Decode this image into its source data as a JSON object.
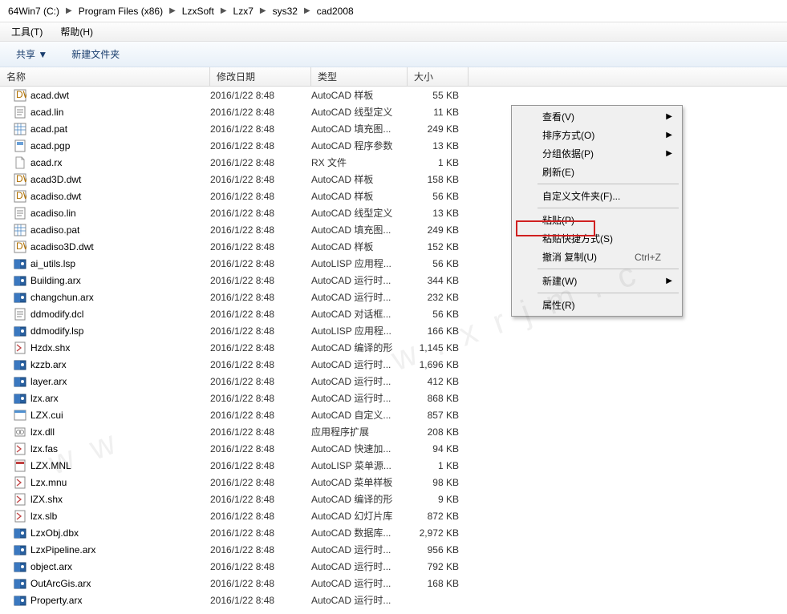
{
  "breadcrumb": [
    "64Win7 (C:)",
    "Program Files (x86)",
    "LzxSoft",
    "Lzx7",
    "sys32",
    "cad2008"
  ],
  "menubar": {
    "tools": "工具(T)",
    "help": "帮助(H)"
  },
  "toolbar": {
    "share": "共享 ▼",
    "newfolder": "新建文件夹"
  },
  "columns": {
    "name": "名称",
    "date": "修改日期",
    "type": "类型",
    "size": "大小"
  },
  "files": [
    {
      "icon": "dwt",
      "name": "acad.dwt",
      "date": "2016/1/22 8:48",
      "type": "AutoCAD 样板",
      "size": "55 KB"
    },
    {
      "icon": "txt",
      "name": "acad.lin",
      "date": "2016/1/22 8:48",
      "type": "AutoCAD 线型定义",
      "size": "11 KB"
    },
    {
      "icon": "pat",
      "name": "acad.pat",
      "date": "2016/1/22 8:48",
      "type": "AutoCAD 填充图...",
      "size": "249 KB"
    },
    {
      "icon": "gen",
      "name": "acad.pgp",
      "date": "2016/1/22 8:48",
      "type": "AutoCAD 程序参数",
      "size": "13 KB"
    },
    {
      "icon": "blank",
      "name": "acad.rx",
      "date": "2016/1/22 8:48",
      "type": "RX 文件",
      "size": "1 KB"
    },
    {
      "icon": "dwt",
      "name": "acad3D.dwt",
      "date": "2016/1/22 8:48",
      "type": "AutoCAD 样板",
      "size": "158 KB"
    },
    {
      "icon": "dwt",
      "name": "acadiso.dwt",
      "date": "2016/1/22 8:48",
      "type": "AutoCAD 样板",
      "size": "56 KB"
    },
    {
      "icon": "txt",
      "name": "acadiso.lin",
      "date": "2016/1/22 8:48",
      "type": "AutoCAD 线型定义",
      "size": "13 KB"
    },
    {
      "icon": "pat",
      "name": "acadiso.pat",
      "date": "2016/1/22 8:48",
      "type": "AutoCAD 填充图...",
      "size": "249 KB"
    },
    {
      "icon": "dwt",
      "name": "acadiso3D.dwt",
      "date": "2016/1/22 8:48",
      "type": "AutoCAD 样板",
      "size": "152 KB"
    },
    {
      "icon": "arx",
      "name": "ai_utils.lsp",
      "date": "2016/1/22 8:48",
      "type": "AutoLISP 应用程...",
      "size": "56 KB"
    },
    {
      "icon": "arx",
      "name": "Building.arx",
      "date": "2016/1/22 8:48",
      "type": "AutoCAD 运行时...",
      "size": "344 KB"
    },
    {
      "icon": "arx",
      "name": "changchun.arx",
      "date": "2016/1/22 8:48",
      "type": "AutoCAD 运行时...",
      "size": "232 KB"
    },
    {
      "icon": "txt",
      "name": "ddmodify.dcl",
      "date": "2016/1/22 8:48",
      "type": "AutoCAD 对话框...",
      "size": "56 KB"
    },
    {
      "icon": "arx",
      "name": "ddmodify.lsp",
      "date": "2016/1/22 8:48",
      "type": "AutoLISP 应用程...",
      "size": "166 KB"
    },
    {
      "icon": "shx",
      "name": "Hzdx.shx",
      "date": "2016/1/22 8:48",
      "type": "AutoCAD 编译的形",
      "size": "1,145 KB"
    },
    {
      "icon": "arx",
      "name": "kzzb.arx",
      "date": "2016/1/22 8:48",
      "type": "AutoCAD 运行时...",
      "size": "1,696 KB"
    },
    {
      "icon": "arx",
      "name": "layer.arx",
      "date": "2016/1/22 8:48",
      "type": "AutoCAD 运行时...",
      "size": "412 KB"
    },
    {
      "icon": "arx",
      "name": "lzx.arx",
      "date": "2016/1/22 8:48",
      "type": "AutoCAD 运行时...",
      "size": "868 KB"
    },
    {
      "icon": "cui",
      "name": "LZX.cui",
      "date": "2016/1/22 8:48",
      "type": "AutoCAD 自定义...",
      "size": "857 KB"
    },
    {
      "icon": "dll",
      "name": "lzx.dll",
      "date": "2016/1/22 8:48",
      "type": "应用程序扩展",
      "size": "208 KB"
    },
    {
      "icon": "shx",
      "name": "lzx.fas",
      "date": "2016/1/22 8:48",
      "type": "AutoCAD 快速加...",
      "size": "94 KB"
    },
    {
      "icon": "mnl",
      "name": "LZX.MNL",
      "date": "2016/1/22 8:48",
      "type": "AutoLISP 菜单源...",
      "size": "1 KB"
    },
    {
      "icon": "shx",
      "name": "Lzx.mnu",
      "date": "2016/1/22 8:48",
      "type": "AutoCAD 菜单样板",
      "size": "98 KB"
    },
    {
      "icon": "shx",
      "name": "lZX.shx",
      "date": "2016/1/22 8:48",
      "type": "AutoCAD 编译的形",
      "size": "9 KB"
    },
    {
      "icon": "shx",
      "name": "lzx.slb",
      "date": "2016/1/22 8:48",
      "type": "AutoCAD 幻灯片库",
      "size": "872 KB"
    },
    {
      "icon": "arx",
      "name": "LzxObj.dbx",
      "date": "2016/1/22 8:48",
      "type": "AutoCAD 数据库...",
      "size": "2,972 KB"
    },
    {
      "icon": "arx",
      "name": "LzxPipeline.arx",
      "date": "2016/1/22 8:48",
      "type": "AutoCAD 运行时...",
      "size": "956 KB"
    },
    {
      "icon": "arx",
      "name": "object.arx",
      "date": "2016/1/22 8:48",
      "type": "AutoCAD 运行时...",
      "size": "792 KB"
    },
    {
      "icon": "arx",
      "name": "OutArcGis.arx",
      "date": "2016/1/22 8:48",
      "type": "AutoCAD 运行时...",
      "size": "168 KB"
    },
    {
      "icon": "arx",
      "name": "Property.arx",
      "date": "2016/1/22 8:48",
      "type": "AutoCAD 运行时...",
      "size": ""
    }
  ],
  "context_menu": {
    "view": "查看(V)",
    "sort": "排序方式(O)",
    "group": "分组依据(P)",
    "refresh": "刷新(E)",
    "customize": "自定义文件夹(F)...",
    "paste": "粘贴(P)",
    "paste_shortcut": "粘贴快捷方式(S)",
    "undo": "撤消 复制(U)",
    "undo_sc": "Ctrl+Z",
    "new": "新建(W)",
    "props": "属性(R)"
  }
}
